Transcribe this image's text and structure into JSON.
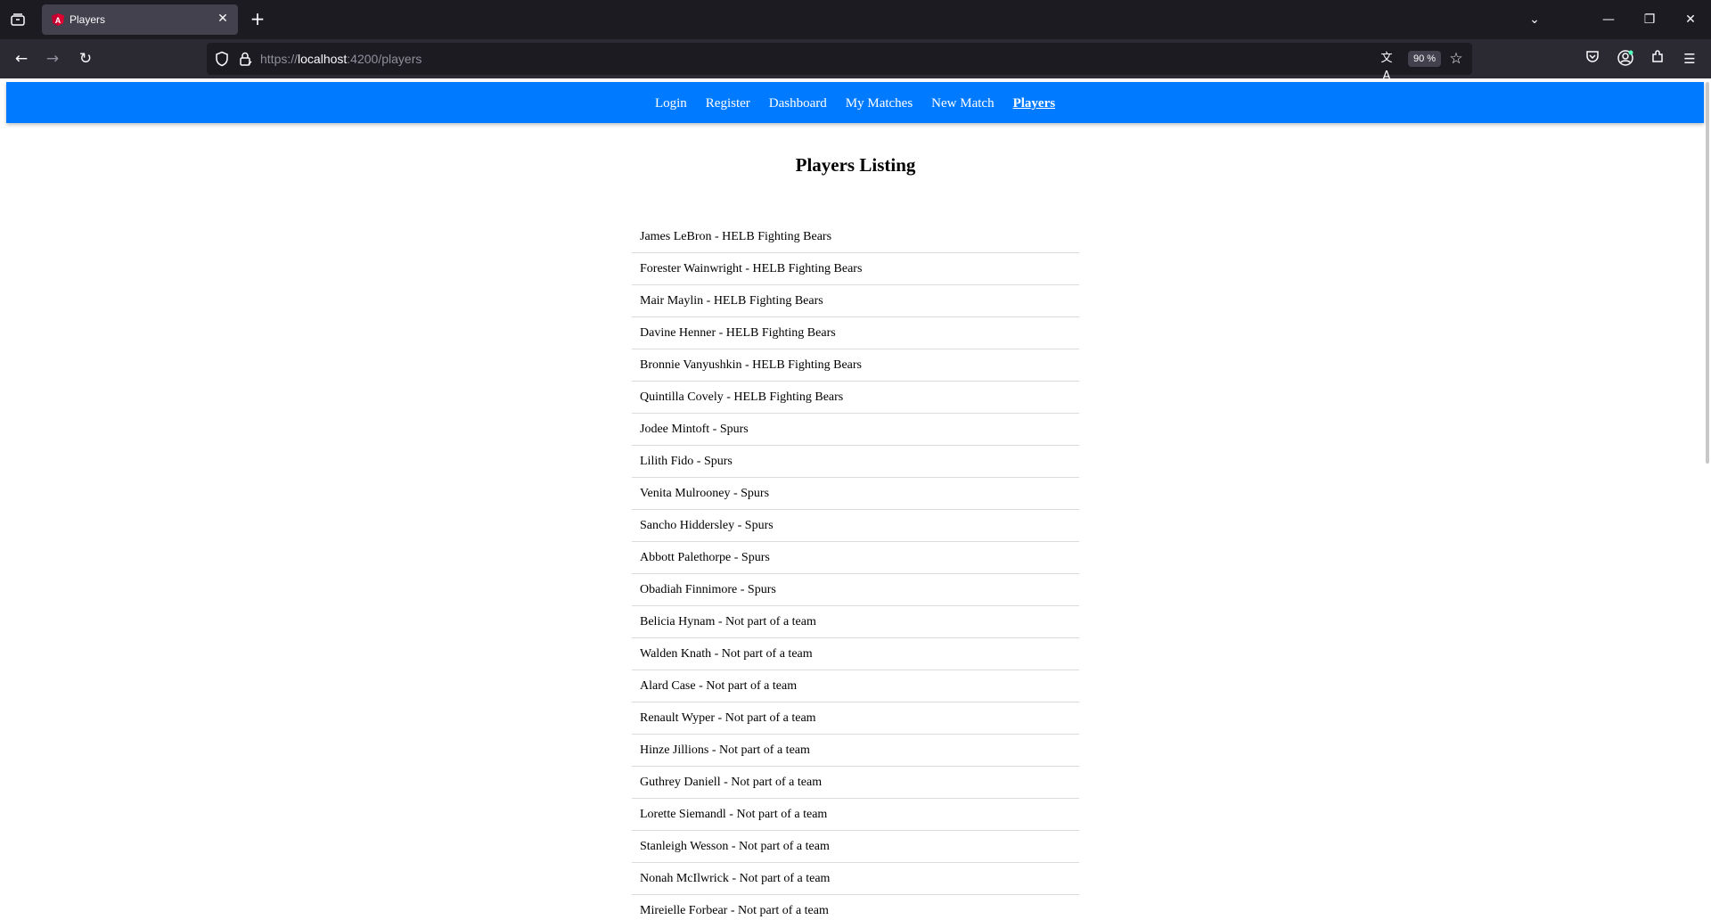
{
  "browser": {
    "tab_title": "Players",
    "url_prefix": "https://",
    "url_host": "localhost",
    "url_path": ":4200/players",
    "zoom": "90 %"
  },
  "nav": {
    "links": [
      "Login",
      "Register",
      "Dashboard",
      "My Matches",
      "New Match",
      "Players"
    ],
    "active": "Players"
  },
  "heading": "Players Listing",
  "players": [
    "James LeBron - HELB Fighting Bears",
    "Forester Wainwright - HELB Fighting Bears",
    "Mair Maylin - HELB Fighting Bears",
    "Davine Henner - HELB Fighting Bears",
    "Bronnie Vanyushkin - HELB Fighting Bears",
    "Quintilla Covely - HELB Fighting Bears",
    "Jodee Mintoft - Spurs",
    "Lilith Fido - Spurs",
    "Venita Mulrooney - Spurs",
    "Sancho Hiddersley - Spurs",
    "Abbott Palethorpe - Spurs",
    "Obadiah Finnimore - Spurs",
    "Belicia Hynam - Not part of a team",
    "Walden Knath - Not part of a team",
    "Alard Case - Not part of a team",
    "Renault Wyper - Not part of a team",
    "Hinze Jillions - Not part of a team",
    "Guthrey Daniell - Not part of a team",
    "Lorette Siemandl - Not part of a team",
    "Stanleigh Wesson - Not part of a team",
    "Nonah McIlwrick - Not part of a team",
    "Mireielle Forbear - Not part of a team"
  ],
  "icons": {
    "tablist": "tab-list-icon",
    "favicon": "angular-favicon-icon",
    "close": "close-icon",
    "newtab": "plus-icon",
    "back": "back-arrow-icon",
    "forward": "forward-arrow-icon",
    "reload": "reload-icon",
    "shield": "shield-icon",
    "lock": "lock-icon",
    "translate": "translate-icon",
    "star": "bookmark-star-icon",
    "pocket": "pocket-icon",
    "account": "account-icon",
    "extensions": "extensions-icon",
    "menu": "hamburger-menu-icon"
  },
  "colors": {
    "nav_bg": "#007bff",
    "browser_bg": "#1c1b22",
    "toolbar_bg": "#2b2a33"
  }
}
